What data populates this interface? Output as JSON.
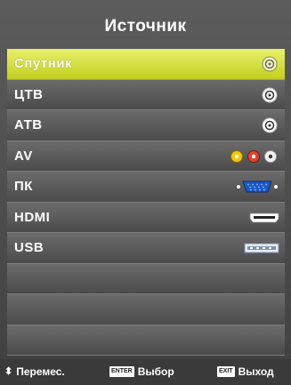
{
  "title": "Источник",
  "items": [
    {
      "label": "Спутник",
      "icon": "satellite-rf-jack-icon",
      "selected": true
    },
    {
      "label": "ЦТВ",
      "icon": "rf-jack-icon"
    },
    {
      "label": "АТВ",
      "icon": "rf-jack-icon"
    },
    {
      "label": "AV",
      "icon": "rca-av-jacks-icon"
    },
    {
      "label": "ПК",
      "icon": "vga-connector-icon"
    },
    {
      "label": "HDMI",
      "icon": "hdmi-port-icon"
    },
    {
      "label": "USB",
      "icon": "usb-port-icon"
    },
    {
      "label": ""
    },
    {
      "label": ""
    },
    {
      "label": ""
    }
  ],
  "footer": {
    "move_label": "Перемес.",
    "select_key": "ENTER",
    "select_label": "Выбор",
    "exit_key": "EXIT",
    "exit_label": "Выход"
  },
  "colors": {
    "selected_highlight": "#d6e03a",
    "row_background": "#5a5a5a"
  }
}
